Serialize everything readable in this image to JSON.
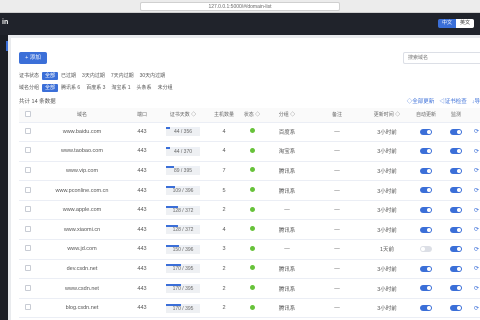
{
  "browser": {
    "url": "127.0.0.1:5000/#/domain-list"
  },
  "header": {
    "logo": "in",
    "lang_active": "中文",
    "lang_inactive": "英文"
  },
  "toolbar": {
    "add_label": "+ 添加",
    "search_placeholder": "搜索域名"
  },
  "filters": {
    "cert_status": {
      "label": "证书状态",
      "options": [
        "全部",
        "已过期",
        "3天内过期",
        "7天内过期",
        "30天内过期"
      ],
      "active": 0
    },
    "domain_group": {
      "label": "域名分组",
      "options": [
        "全部",
        "腾讯系 6",
        "百度系 3",
        "淘宝系 1",
        "头条系",
        "未分组"
      ],
      "active": 0
    }
  },
  "summary": {
    "total_text": "共计 14 条数据"
  },
  "actions": {
    "update_all": "◇全部更新",
    "cert_check": "◁证书检查",
    "export": "↓导"
  },
  "columns": [
    "",
    "域名",
    "端口",
    "证书天数 ◇",
    "主机数量",
    "状态 ◇",
    "分组 ◇",
    "备注",
    "更新时间 ◇",
    "自动更新",
    "监测",
    ""
  ],
  "rows": [
    {
      "domain": "www.baidu.com",
      "port": "443",
      "days": "44 / 356",
      "hosts": "4",
      "group": "百度系",
      "note": "—",
      "updated": "3小时前",
      "auto": true,
      "monitor": true
    },
    {
      "domain": "www.taobao.com",
      "port": "443",
      "days": "44 / 370",
      "hosts": "4",
      "group": "淘宝系",
      "note": "—",
      "updated": "3小时前",
      "auto": true,
      "monitor": true
    },
    {
      "domain": "www.vip.com",
      "port": "443",
      "days": "89 / 395",
      "hosts": "7",
      "group": "腾讯系",
      "note": "—",
      "updated": "3小时前",
      "auto": true,
      "monitor": true
    },
    {
      "domain": "www.pconline.com.cn",
      "port": "443",
      "days": "109 / 396",
      "hosts": "5",
      "group": "腾讯系",
      "note": "—",
      "updated": "3小时前",
      "auto": true,
      "monitor": true
    },
    {
      "domain": "www.apple.com",
      "port": "443",
      "days": "128 / 372",
      "hosts": "2",
      "group": "—",
      "note": "—",
      "updated": "3小时前",
      "auto": true,
      "monitor": true
    },
    {
      "domain": "www.xiaomi.cn",
      "port": "443",
      "days": "128 / 372",
      "hosts": "4",
      "group": "腾讯系",
      "note": "—",
      "updated": "3小时前",
      "auto": true,
      "monitor": true
    },
    {
      "domain": "www.jd.com",
      "port": "443",
      "days": "150 / 396",
      "hosts": "3",
      "group": "—",
      "note": "—",
      "updated": "1天前",
      "auto": false,
      "monitor": true
    },
    {
      "domain": "dev.csdn.net",
      "port": "443",
      "days": "170 / 395",
      "hosts": "2",
      "group": "腾讯系",
      "note": "—",
      "updated": "3小时前",
      "auto": true,
      "monitor": true
    },
    {
      "domain": "www.csdn.net",
      "port": "443",
      "days": "170 / 395",
      "hosts": "2",
      "group": "腾讯系",
      "note": "—",
      "updated": "3小时前",
      "auto": true,
      "monitor": true
    },
    {
      "domain": "blog.csdn.net",
      "port": "443",
      "days": "170 / 395",
      "hosts": "2",
      "group": "腾讯系",
      "note": "—",
      "updated": "3小时前",
      "auto": true,
      "monitor": true
    }
  ],
  "colors": {
    "accent": "#3b6fd8",
    "status_ok": "#67c23a",
    "header_bg": "#20232b"
  }
}
